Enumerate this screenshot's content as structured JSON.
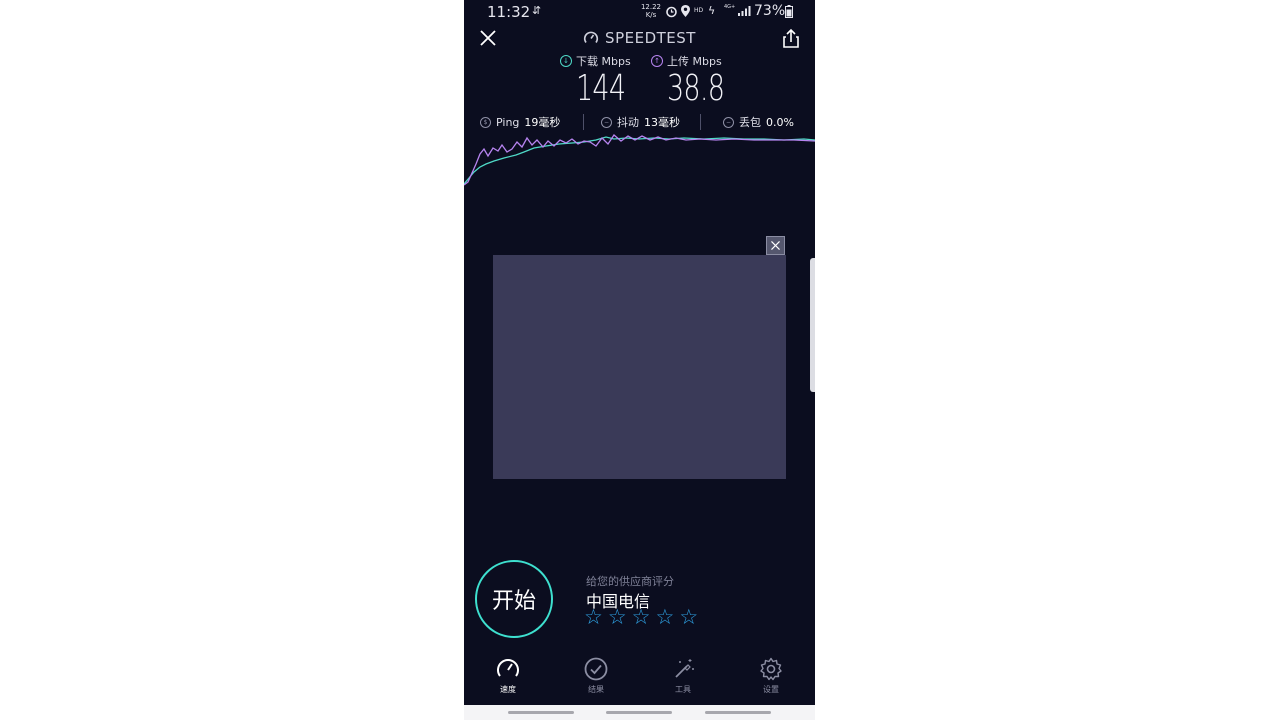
{
  "status_bar": {
    "time": "11:32",
    "net_speed_value": "12.22",
    "net_speed_unit": "K/s",
    "battery": "73%",
    "network": "4G+",
    "hd": "HD"
  },
  "header": {
    "title": "SPEEDTEST"
  },
  "metrics": {
    "download": {
      "label": "下载 Mbps",
      "value": "144",
      "color": "#4fd9c7"
    },
    "upload": {
      "label": "上传 Mbps",
      "value": "38.8",
      "color": "#b784f0"
    }
  },
  "stats": {
    "ping": {
      "label": "Ping",
      "value": "19毫秒"
    },
    "jitter": {
      "label": "抖动",
      "value": "13毫秒"
    },
    "loss": {
      "label": "丢包",
      "value": "0.0%"
    }
  },
  "graph": {
    "download_color": "#4fd9c7",
    "upload_color": "#b784f0"
  },
  "start_button": {
    "label": "开始",
    "ring_color": "#3ee0cf"
  },
  "rating": {
    "prompt": "给您的供应商评分",
    "provider": "中国电信",
    "stars_max": 5,
    "stars_selected": 0,
    "star_color": "#2e9fe0"
  },
  "nav": {
    "items": [
      {
        "label": "速度",
        "icon": "speedometer-icon",
        "active": true
      },
      {
        "label": "结果",
        "icon": "check-circle-icon",
        "active": false
      },
      {
        "label": "工具",
        "icon": "magic-wand-icon",
        "active": false
      },
      {
        "label": "设置",
        "icon": "gear-icon",
        "active": false
      }
    ]
  },
  "colors": {
    "background": "#0b0d1f",
    "ad_placeholder": "#3a3a58"
  }
}
